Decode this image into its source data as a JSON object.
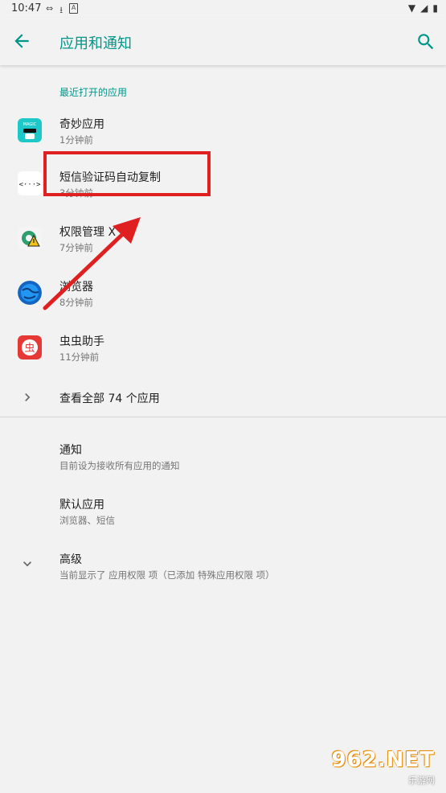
{
  "status_bar": {
    "time": "10:47",
    "left_icons": [
      "link-icon",
      "download-icon",
      "a-box-icon"
    ],
    "right_icons": [
      "wifi-icon",
      "signal-icon",
      "battery-icon"
    ]
  },
  "app_bar": {
    "title": "应用和通知",
    "back_icon": "arrow-back-icon",
    "search_icon": "search-icon"
  },
  "recent": {
    "label": "最近打开的应用",
    "apps": [
      {
        "name": "奇妙应用",
        "time": "1分钟前",
        "icon": "magic-app-icon",
        "icon_text": "MAGIC"
      },
      {
        "name": "短信验证码自动复制",
        "time": "3分钟前",
        "icon": "code-brackets-icon",
        "icon_text": "<···>"
      },
      {
        "name": "权限管理 X",
        "time": "7分钟前",
        "icon": "gear-warning-icon",
        "icon_text": ""
      },
      {
        "name": "浏览器",
        "time": "8分钟前",
        "icon": "globe-icon",
        "icon_text": ""
      },
      {
        "name": "虫虫助手",
        "time": "11分钟前",
        "icon": "chongchong-icon",
        "icon_text": "虫"
      }
    ],
    "see_all": "查看全部 74 个应用"
  },
  "settings": [
    {
      "title": "通知",
      "subtitle": "目前设为接收所有应用的通知"
    },
    {
      "title": "默认应用",
      "subtitle": "浏览器、短信"
    },
    {
      "title": "高级",
      "subtitle": "当前显示了 应用权限 项（已添加 特殊应用权限 项）"
    }
  ],
  "colors": {
    "accent": "#009688",
    "background": "#f2f2f2",
    "annotation": "#e02020"
  },
  "watermark": {
    "main": "962.NET",
    "sub": "乐游网"
  }
}
